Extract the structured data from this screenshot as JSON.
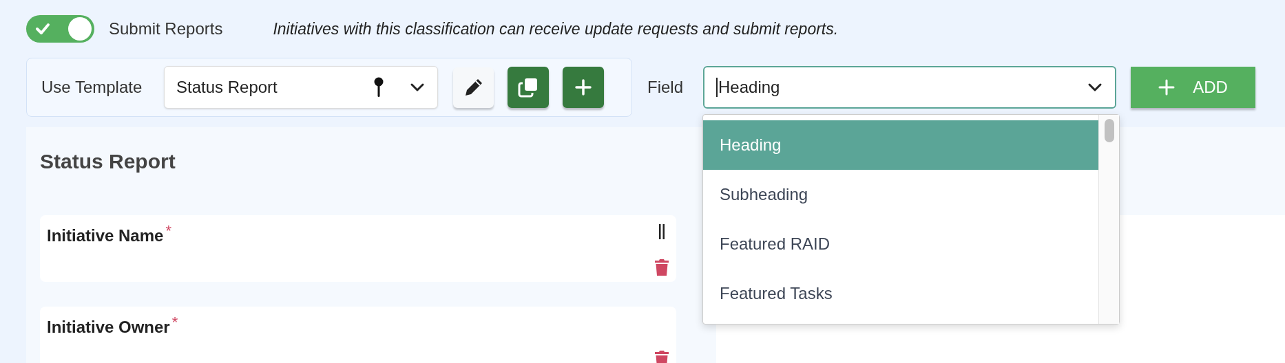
{
  "toggle": {
    "label": "Submit Reports",
    "on": true
  },
  "description": "Initiatives with this classification can receive update requests and submit reports.",
  "template": {
    "label": "Use Template",
    "value": "Status Report"
  },
  "field": {
    "label": "Field",
    "value": "Heading"
  },
  "add_button": {
    "label": "ADD"
  },
  "dropdown": {
    "options": [
      {
        "label": "Heading",
        "selected": true
      },
      {
        "label": "Subheading",
        "selected": false
      },
      {
        "label": "Featured RAID",
        "selected": false
      },
      {
        "label": "Featured Tasks",
        "selected": false
      }
    ]
  },
  "section_title": "Status Report",
  "cards": [
    {
      "label": "Initiative Name",
      "required": true,
      "required_mark": "*",
      "kind": "draggable"
    },
    {
      "label": "Initiative Owner",
      "required": true,
      "required_mark": "*",
      "kind": "fixed"
    }
  ]
}
